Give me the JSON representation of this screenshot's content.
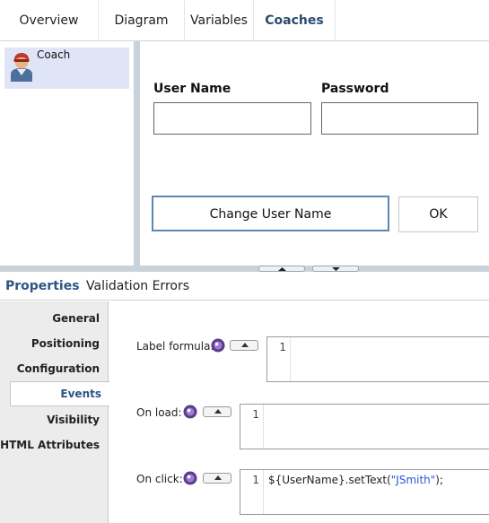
{
  "top_tabs": [
    {
      "label": "Overview"
    },
    {
      "label": "Diagram"
    },
    {
      "label": "Variables"
    },
    {
      "label": "Coaches",
      "active": true
    }
  ],
  "coach_list": {
    "items": [
      {
        "label": "Coach",
        "icon": "coach-user-icon",
        "selected": true
      }
    ]
  },
  "canvas": {
    "username_label": "User Name",
    "password_label": "Password",
    "username_value": "",
    "password_value": "",
    "change_button_label": "Change User Name",
    "ok_button_label": "OK"
  },
  "bottom_tabs": [
    {
      "label": "Properties",
      "active": true
    },
    {
      "label": "Validation Errors"
    }
  ],
  "property_nav": [
    {
      "label": "General"
    },
    {
      "label": "Positioning"
    },
    {
      "label": "Configuration"
    },
    {
      "label": "Events",
      "active": true
    },
    {
      "label": "Visibility"
    },
    {
      "label": "HTML Attributes"
    }
  ],
  "events": {
    "label_formula": {
      "label": "Label formula:",
      "line": "1",
      "code": ""
    },
    "on_load": {
      "label": "On load:",
      "line": "1",
      "code": ""
    },
    "on_click": {
      "label": "On click:",
      "line": "1",
      "code_prefix": "${UserName}.setText(",
      "code_string": "\"JSmith\"",
      "code_suffix": ");"
    }
  },
  "colors": {
    "active_tab": "#2c4a6e",
    "selection": "#dfe5f7",
    "splitter": "#c9d3dc",
    "focus_border": "#5b86b7",
    "string_literal": "#2a55d6"
  }
}
